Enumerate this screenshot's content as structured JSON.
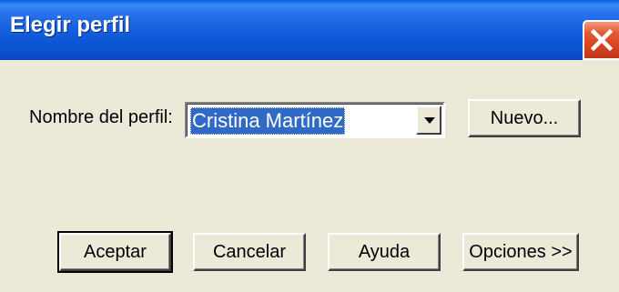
{
  "window": {
    "title": "Elegir perfil",
    "close_icon": "close-icon"
  },
  "profile": {
    "label": "Nombre del perfil:",
    "selected": "Cristina Martínez",
    "dropdown_icon": "chevron-down-icon"
  },
  "buttons": {
    "new": "Nuevo...",
    "accept": "Aceptar",
    "cancel": "Cancelar",
    "help": "Ayuda",
    "options": "Opciones >>"
  },
  "colors": {
    "titlebar": "#0B55D8",
    "close": "#D5431E",
    "selection": "#316AC5",
    "face": "#ECE9D8"
  }
}
